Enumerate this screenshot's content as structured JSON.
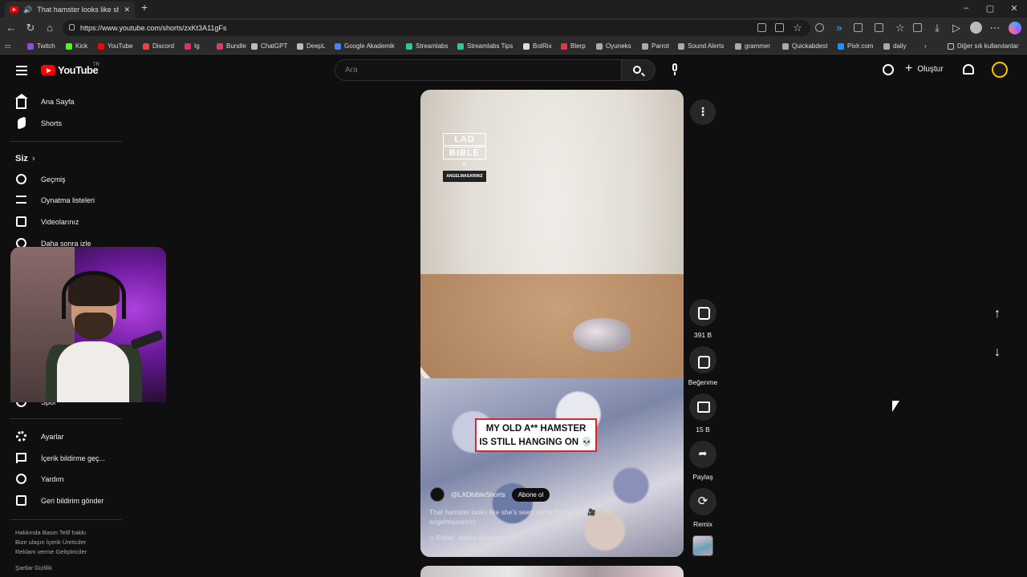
{
  "browser": {
    "tab_title": "That hamster looks like she's",
    "url": "https://www.youtube.com/shorts/zxKt3A11gFs",
    "bookmarks": [
      {
        "label": "Twitch",
        "color": "#9146ff"
      },
      {
        "label": "Kick",
        "color": "#53fc18"
      },
      {
        "label": "YouTube",
        "color": "#ff0000"
      },
      {
        "label": "Discord",
        "color": "#ed4245"
      },
      {
        "label": "Ig",
        "color": "#e1306c"
      },
      {
        "label": "Bundle",
        "color": "#d4435b"
      },
      {
        "label": "ChatGPT",
        "color": "#bbbbbb"
      },
      {
        "label": "DeepL",
        "color": "#bbbbbb"
      },
      {
        "label": "Google Akademik",
        "color": "#4285f4"
      },
      {
        "label": "Streamlabs",
        "color": "#31c3a2"
      },
      {
        "label": "Streamlabs Tips",
        "color": "#31c3a2"
      },
      {
        "label": "BotRix",
        "color": "#dddddd"
      },
      {
        "label": "Blerp",
        "color": "#e8334a"
      },
      {
        "label": "Oyuneks",
        "color": "#aaaaaa"
      },
      {
        "label": "Parrot",
        "color": "#aaaaaa"
      },
      {
        "label": "Sound Alerts",
        "color": "#aaaaaa"
      },
      {
        "label": "grammer",
        "color": "#aaaaaa"
      },
      {
        "label": "Quickabdest",
        "color": "#aaaaaa"
      },
      {
        "label": "Pixlr.com",
        "color": "#1e90ff"
      },
      {
        "label": "daily",
        "color": "#aaaaaa"
      }
    ],
    "other_bookmarks": "Diğer sık kullanılanlar"
  },
  "header": {
    "logo_text": "YouTube",
    "country": "TR",
    "search_placeholder": "Ara",
    "create_label": "Oluştur"
  },
  "sidebar": {
    "home": "Ana Sayfa",
    "shorts": "Shorts",
    "you": "Siz",
    "history": "Geçmiş",
    "playlists": "Oynatma listeleri",
    "your_videos": "Videolarınız",
    "watch_later": "Daha sonra izle",
    "sports": "Spor",
    "settings": "Ayarlar",
    "report": "İçerik bildirme geç...",
    "help": "Yardım",
    "feedback": "Geri bildirim gönder",
    "footer1": "Hakkında   Basın   Telif hakkı",
    "footer2": "Bize ulaşın   İçerik Üreticiler",
    "footer3": "Reklam verme   Geliştiriciler",
    "footer4": "Şartlar   Gizlilik"
  },
  "short": {
    "brand_top": "LAD",
    "brand_bottom": "BIBLE",
    "brand_x": "×",
    "brand_tag": "ANGELMASARINIZ",
    "caption_line1": "MY OLD A** HAMSTER",
    "caption_line2": "IS STILL HANGING ON 💀",
    "channel": "@LADbibleShorts",
    "subscribe": "Abone ol",
    "description": "That hamster looks like she's seen some things 😅 ( 🎥 : TT/ angelmasarinz)",
    "music": "♫ Pitfall · Arthur Benson"
  },
  "actions": {
    "likes": "391 B",
    "dislike": "Beğenme",
    "comments": "15 B",
    "share": "Paylaş",
    "remix": "Remix"
  }
}
